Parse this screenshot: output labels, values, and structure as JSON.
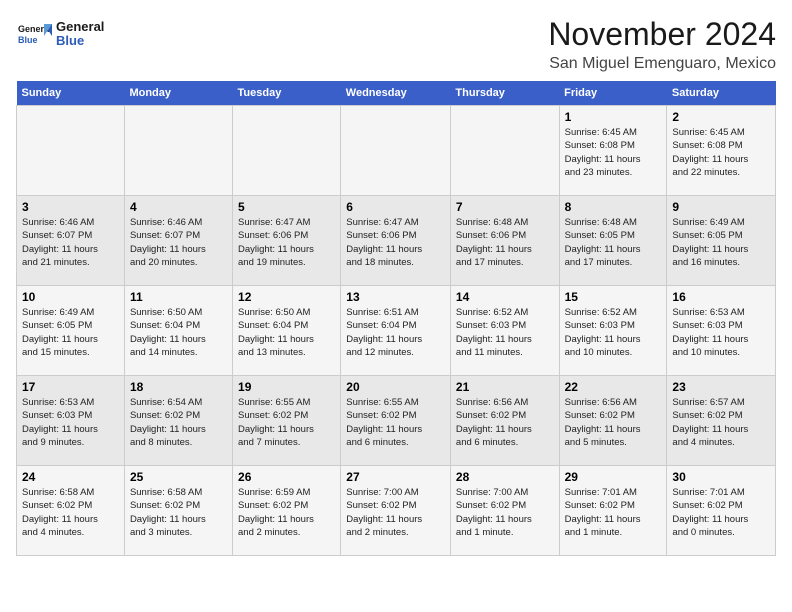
{
  "header": {
    "logo_general": "General",
    "logo_blue": "Blue",
    "month": "November 2024",
    "location": "San Miguel Emenguaro, Mexico"
  },
  "weekdays": [
    "Sunday",
    "Monday",
    "Tuesday",
    "Wednesday",
    "Thursday",
    "Friday",
    "Saturday"
  ],
  "weeks": [
    [
      {
        "day": "",
        "detail": ""
      },
      {
        "day": "",
        "detail": ""
      },
      {
        "day": "",
        "detail": ""
      },
      {
        "day": "",
        "detail": ""
      },
      {
        "day": "",
        "detail": ""
      },
      {
        "day": "1",
        "detail": "Sunrise: 6:45 AM\nSunset: 6:08 PM\nDaylight: 11 hours\nand 23 minutes."
      },
      {
        "day": "2",
        "detail": "Sunrise: 6:45 AM\nSunset: 6:08 PM\nDaylight: 11 hours\nand 22 minutes."
      }
    ],
    [
      {
        "day": "3",
        "detail": "Sunrise: 6:46 AM\nSunset: 6:07 PM\nDaylight: 11 hours\nand 21 minutes."
      },
      {
        "day": "4",
        "detail": "Sunrise: 6:46 AM\nSunset: 6:07 PM\nDaylight: 11 hours\nand 20 minutes."
      },
      {
        "day": "5",
        "detail": "Sunrise: 6:47 AM\nSunset: 6:06 PM\nDaylight: 11 hours\nand 19 minutes."
      },
      {
        "day": "6",
        "detail": "Sunrise: 6:47 AM\nSunset: 6:06 PM\nDaylight: 11 hours\nand 18 minutes."
      },
      {
        "day": "7",
        "detail": "Sunrise: 6:48 AM\nSunset: 6:06 PM\nDaylight: 11 hours\nand 17 minutes."
      },
      {
        "day": "8",
        "detail": "Sunrise: 6:48 AM\nSunset: 6:05 PM\nDaylight: 11 hours\nand 17 minutes."
      },
      {
        "day": "9",
        "detail": "Sunrise: 6:49 AM\nSunset: 6:05 PM\nDaylight: 11 hours\nand 16 minutes."
      }
    ],
    [
      {
        "day": "10",
        "detail": "Sunrise: 6:49 AM\nSunset: 6:05 PM\nDaylight: 11 hours\nand 15 minutes."
      },
      {
        "day": "11",
        "detail": "Sunrise: 6:50 AM\nSunset: 6:04 PM\nDaylight: 11 hours\nand 14 minutes."
      },
      {
        "day": "12",
        "detail": "Sunrise: 6:50 AM\nSunset: 6:04 PM\nDaylight: 11 hours\nand 13 minutes."
      },
      {
        "day": "13",
        "detail": "Sunrise: 6:51 AM\nSunset: 6:04 PM\nDaylight: 11 hours\nand 12 minutes."
      },
      {
        "day": "14",
        "detail": "Sunrise: 6:52 AM\nSunset: 6:03 PM\nDaylight: 11 hours\nand 11 minutes."
      },
      {
        "day": "15",
        "detail": "Sunrise: 6:52 AM\nSunset: 6:03 PM\nDaylight: 11 hours\nand 10 minutes."
      },
      {
        "day": "16",
        "detail": "Sunrise: 6:53 AM\nSunset: 6:03 PM\nDaylight: 11 hours\nand 10 minutes."
      }
    ],
    [
      {
        "day": "17",
        "detail": "Sunrise: 6:53 AM\nSunset: 6:03 PM\nDaylight: 11 hours\nand 9 minutes."
      },
      {
        "day": "18",
        "detail": "Sunrise: 6:54 AM\nSunset: 6:02 PM\nDaylight: 11 hours\nand 8 minutes."
      },
      {
        "day": "19",
        "detail": "Sunrise: 6:55 AM\nSunset: 6:02 PM\nDaylight: 11 hours\nand 7 minutes."
      },
      {
        "day": "20",
        "detail": "Sunrise: 6:55 AM\nSunset: 6:02 PM\nDaylight: 11 hours\nand 6 minutes."
      },
      {
        "day": "21",
        "detail": "Sunrise: 6:56 AM\nSunset: 6:02 PM\nDaylight: 11 hours\nand 6 minutes."
      },
      {
        "day": "22",
        "detail": "Sunrise: 6:56 AM\nSunset: 6:02 PM\nDaylight: 11 hours\nand 5 minutes."
      },
      {
        "day": "23",
        "detail": "Sunrise: 6:57 AM\nSunset: 6:02 PM\nDaylight: 11 hours\nand 4 minutes."
      }
    ],
    [
      {
        "day": "24",
        "detail": "Sunrise: 6:58 AM\nSunset: 6:02 PM\nDaylight: 11 hours\nand 4 minutes."
      },
      {
        "day": "25",
        "detail": "Sunrise: 6:58 AM\nSunset: 6:02 PM\nDaylight: 11 hours\nand 3 minutes."
      },
      {
        "day": "26",
        "detail": "Sunrise: 6:59 AM\nSunset: 6:02 PM\nDaylight: 11 hours\nand 2 minutes."
      },
      {
        "day": "27",
        "detail": "Sunrise: 7:00 AM\nSunset: 6:02 PM\nDaylight: 11 hours\nand 2 minutes."
      },
      {
        "day": "28",
        "detail": "Sunrise: 7:00 AM\nSunset: 6:02 PM\nDaylight: 11 hours\nand 1 minute."
      },
      {
        "day": "29",
        "detail": "Sunrise: 7:01 AM\nSunset: 6:02 PM\nDaylight: 11 hours\nand 1 minute."
      },
      {
        "day": "30",
        "detail": "Sunrise: 7:01 AM\nSunset: 6:02 PM\nDaylight: 11 hours\nand 0 minutes."
      }
    ]
  ]
}
